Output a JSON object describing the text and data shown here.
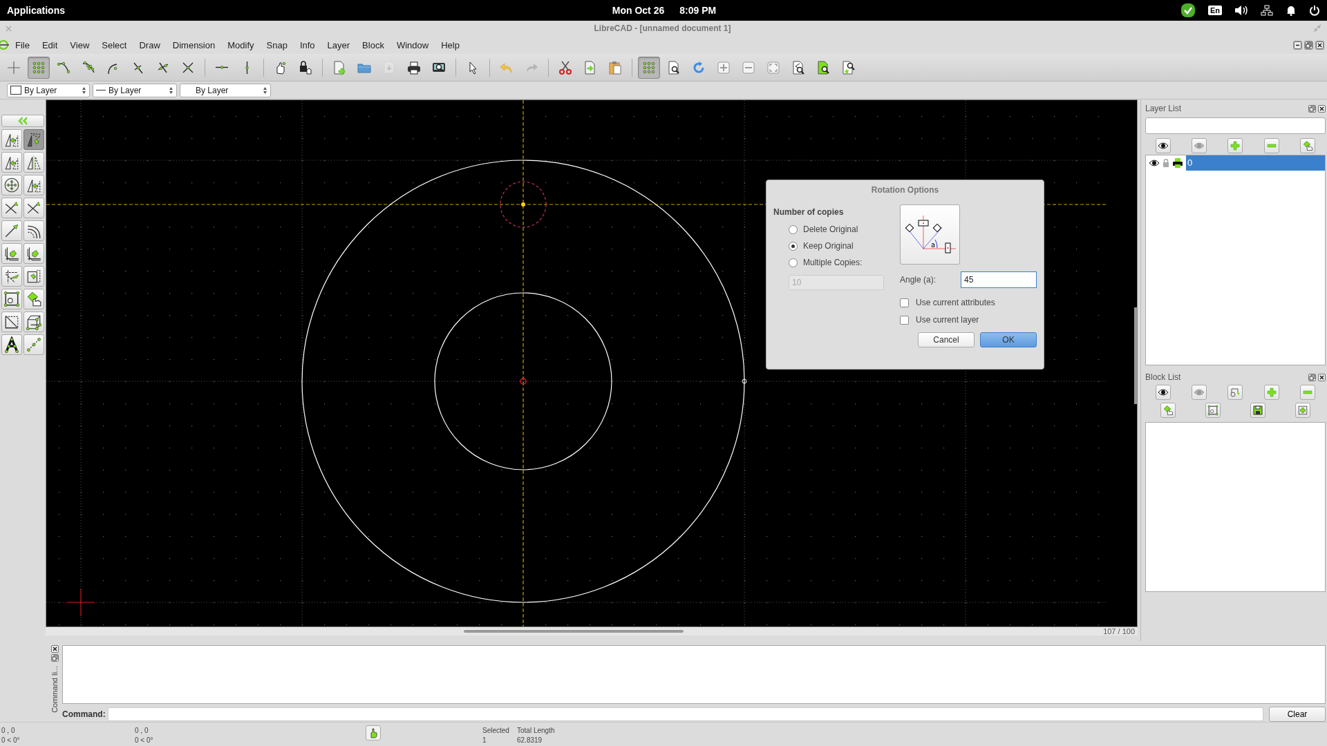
{
  "top_panel": {
    "applications": "Applications",
    "date": "Mon Oct 26",
    "time": "8:09 PM",
    "keyboard_layout": "En"
  },
  "window": {
    "title": "LibreCAD - [unnamed document 1]"
  },
  "menu": [
    "File",
    "Edit",
    "View",
    "Select",
    "Draw",
    "Dimension",
    "Modify",
    "Snap",
    "Info",
    "Layer",
    "Block",
    "Window",
    "Help"
  ],
  "toolbar": {
    "groups": [
      [
        {
          "kind": "free",
          "on": false,
          "disabled": false
        },
        {
          "kind": "grid",
          "on": true,
          "disabled": false
        },
        {
          "kind": "endpoint",
          "on": false,
          "disabled": false
        },
        {
          "kind": "onentity",
          "on": false,
          "disabled": false
        },
        {
          "kind": "center",
          "on": false,
          "disabled": false
        },
        {
          "kind": "middle",
          "on": false,
          "disabled": false
        },
        {
          "kind": "distance",
          "on": false,
          "disabled": false
        },
        {
          "kind": "intersection",
          "on": false,
          "disabled": false
        }
      ],
      [
        {
          "kind": "horizontal",
          "on": false,
          "disabled": false
        },
        {
          "kind": "vertical",
          "on": false,
          "disabled": false
        }
      ],
      [
        {
          "kind": "relzero",
          "on": false,
          "disabled": false
        },
        {
          "kind": "lockzero",
          "on": false,
          "disabled": false
        }
      ],
      [
        {
          "kind": "new",
          "on": false,
          "disabled": false
        },
        {
          "kind": "open",
          "on": false,
          "disabled": false
        },
        {
          "kind": "save",
          "on": false,
          "disabled": true
        },
        {
          "kind": "print",
          "on": false,
          "disabled": false
        },
        {
          "kind": "preview",
          "on": false,
          "disabled": false
        }
      ],
      [
        {
          "kind": "select",
          "on": false,
          "disabled": false
        }
      ],
      [
        {
          "kind": "undo",
          "on": false,
          "disabled": false
        },
        {
          "kind": "redo",
          "on": false,
          "disabled": true
        }
      ],
      [
        {
          "kind": "cut",
          "on": false,
          "disabled": false
        },
        {
          "kind": "copy",
          "on": false,
          "disabled": false
        },
        {
          "kind": "paste",
          "on": false,
          "disabled": false
        }
      ],
      [
        {
          "kind": "grid",
          "on": true,
          "disabled": false
        },
        {
          "kind": "zoompage",
          "on": false,
          "disabled": false
        },
        {
          "kind": "redraw",
          "on": false,
          "disabled": false
        },
        {
          "kind": "zoomin",
          "on": false,
          "disabled": false
        },
        {
          "kind": "zoomout",
          "on": false,
          "disabled": false
        },
        {
          "kind": "zoomauto",
          "on": false,
          "disabled": false
        },
        {
          "kind": "zoomprev",
          "on": false,
          "disabled": false
        },
        {
          "kind": "zoomwindow",
          "on": false,
          "disabled": false
        },
        {
          "kind": "zoompan",
          "on": false,
          "disabled": false
        }
      ]
    ]
  },
  "pen_toolbar": {
    "color_setting": "By Layer",
    "width_setting": "By Layer",
    "type_setting": "By Layer"
  },
  "left_toolbar": {
    "back": {
      "kind": "back"
    },
    "tools": [
      {
        "kind": "triangles",
        "selected": false
      },
      {
        "kind": "rotate",
        "selected": true
      },
      {
        "kind": "triangles",
        "selected": false
      },
      {
        "kind": "mirror",
        "selected": false
      },
      {
        "kind": "circle-arrows",
        "selected": false
      },
      {
        "kind": "triangles",
        "selected": false
      },
      {
        "kind": "cross-arrow",
        "selected": false
      },
      {
        "kind": "cross-arrow",
        "selected": false
      },
      {
        "kind": "line-arrow",
        "selected": false
      },
      {
        "kind": "arcs",
        "selected": false
      },
      {
        "kind": "corner",
        "selected": false
      },
      {
        "kind": "corner",
        "selected": false
      },
      {
        "kind": "wedge",
        "selected": false
      },
      {
        "kind": "box-arrow",
        "selected": false
      },
      {
        "kind": "frame",
        "selected": false
      },
      {
        "kind": "hand",
        "selected": false
      },
      {
        "kind": "diagonal",
        "selected": false
      },
      {
        "kind": "cube",
        "selected": false
      },
      {
        "kind": "nodes",
        "selected": false
      },
      {
        "kind": "dots-line",
        "selected": false
      }
    ]
  },
  "canvas": {
    "zoom_reading": "107 / 100"
  },
  "rotation_dialog": {
    "title": "Rotation Options",
    "copies_heading": "Number of copies",
    "options": [
      {
        "label": "Delete Original",
        "selected": false
      },
      {
        "label": "Keep Original",
        "selected": true
      },
      {
        "label": "Multiple Copies:",
        "selected": false
      }
    ],
    "copies_field": {
      "value": "10",
      "disabled": true
    },
    "diagram_label": "a",
    "angle_label": "Angle (a):",
    "angle_field": {
      "value": "45"
    },
    "checkboxes": [
      {
        "label": "Use current attributes",
        "checked": false
      },
      {
        "label": "Use current layer",
        "checked": false
      }
    ],
    "buttons": [
      {
        "label": "Cancel",
        "default": false
      },
      {
        "label": "OK",
        "default": true
      }
    ]
  },
  "layer_list": {
    "title": "Layer List",
    "layers": [
      {
        "name": "0",
        "selected": true
      }
    ]
  },
  "block_list": {
    "title": "Block List"
  },
  "command_dock": {
    "side_label": "Command li...",
    "prompt": "Command:",
    "clear": "Clear"
  },
  "status_bar": {
    "coords": [
      {
        "line1": "0 , 0",
        "line2": "0 < 0°"
      },
      {
        "line1": "0 , 0",
        "line2": "0 < 0°"
      }
    ],
    "selected_label": "Selected",
    "selected_value": "1",
    "length_label": "Total Length",
    "length_value": "62.8319"
  }
}
